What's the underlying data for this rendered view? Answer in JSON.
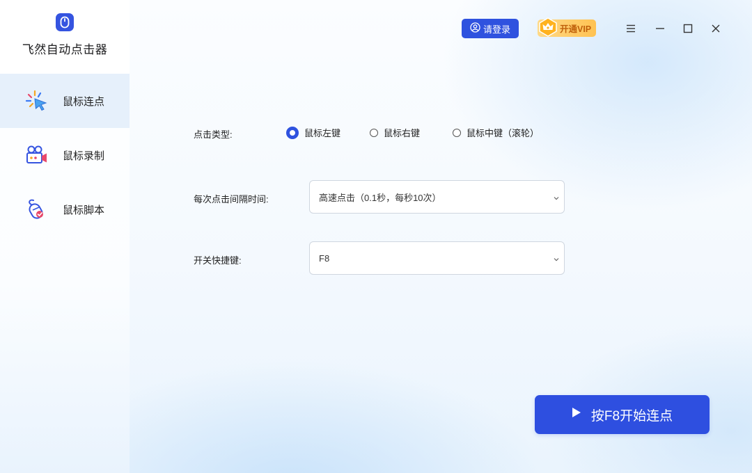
{
  "app": {
    "name": "飞然自动点击器",
    "accent_color": "#2f52df",
    "logo_icon": "mouse-icon"
  },
  "sidebar": {
    "items": [
      {
        "label": "鼠标连点",
        "icon": "mouse-click-icon",
        "active": true
      },
      {
        "label": "鼠标录制",
        "icon": "video-camera-icon",
        "active": false
      },
      {
        "label": "鼠标脚本",
        "icon": "mouse-script-icon",
        "active": false
      }
    ]
  },
  "titlebar": {
    "login_label": "请登录",
    "vip_label": "开通VIP",
    "vip_color": "#ffc252",
    "controls": [
      "menu-icon",
      "minimize-icon",
      "maximize-icon",
      "close-icon"
    ]
  },
  "form": {
    "click_type": {
      "label": "点击类型:",
      "options": [
        "鼠标左键",
        "鼠标右键",
        "鼠标中键（滚轮）"
      ],
      "selected": "鼠标左键"
    },
    "interval": {
      "label": "每次点击间隔时间:",
      "value": "高速点击（0.1秒，每秒10次）"
    },
    "hotkey": {
      "label": "开关快捷键:",
      "value": "F8"
    }
  },
  "start_button": {
    "label": "按F8开始连点",
    "icon": "play-icon"
  }
}
